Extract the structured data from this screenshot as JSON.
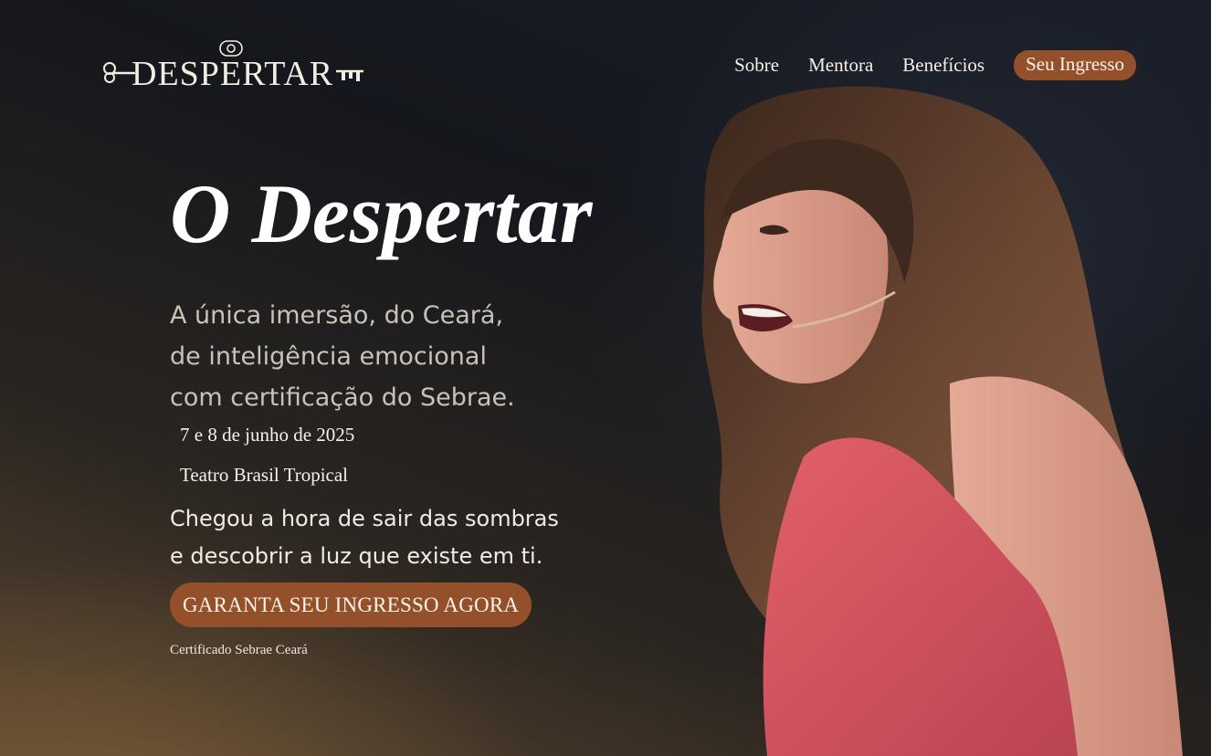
{
  "header": {
    "logo_text": "DESPERTAR",
    "nav": [
      {
        "label": "Sobre"
      },
      {
        "label": "Mentora"
      },
      {
        "label": "Benefícios"
      }
    ],
    "cta_label": "Seu Ingresso"
  },
  "hero": {
    "title": "O Despertar",
    "lead_lines": [
      "A única imersão, do Ceará,",
      "de inteligência emocional",
      "com certificação do Sebrae."
    ],
    "date": "7 e 8 de junho de 2025",
    "venue": "Teatro Brasil Tropical",
    "call_lines": [
      "Chegou a hora de sair das sombras",
      "e descobrir a luz que existe em ti."
    ],
    "cta_label": "GARANTA SEU INGRESSO AGORA",
    "note": "Certificado Sebrae Ceará"
  },
  "colors": {
    "accent": "#94502a",
    "background_top": "#15171d",
    "dress": "#d6535f",
    "hair": "#5a3a28"
  },
  "icons": {
    "logo_key": "key-icon",
    "logo_eye": "eye-icon"
  }
}
